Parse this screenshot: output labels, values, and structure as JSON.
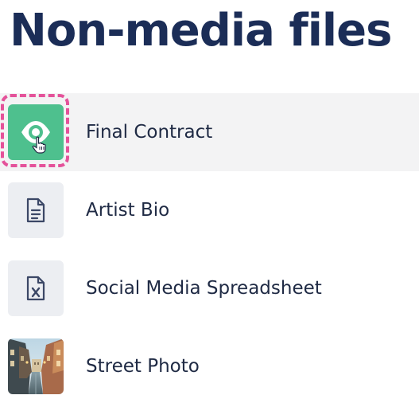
{
  "page": {
    "title": "Non-media files"
  },
  "files": [
    {
      "name": "Final Contract",
      "icon": "eye-icon",
      "state": "hovered-focused"
    },
    {
      "name": "Artist Bio",
      "icon": "document-icon"
    },
    {
      "name": "Social Media Spreadsheet",
      "icon": "spreadsheet-icon"
    },
    {
      "name": "Street Photo",
      "icon": "photo-thumbnail"
    }
  ],
  "colors": {
    "title": "#1b2d57",
    "text": "#1f2a44",
    "preview_green": "#4ec08e",
    "focus_pink": "#e4529a",
    "row_highlight": "#f3f3f4",
    "icon_tile": "#eceef2"
  }
}
